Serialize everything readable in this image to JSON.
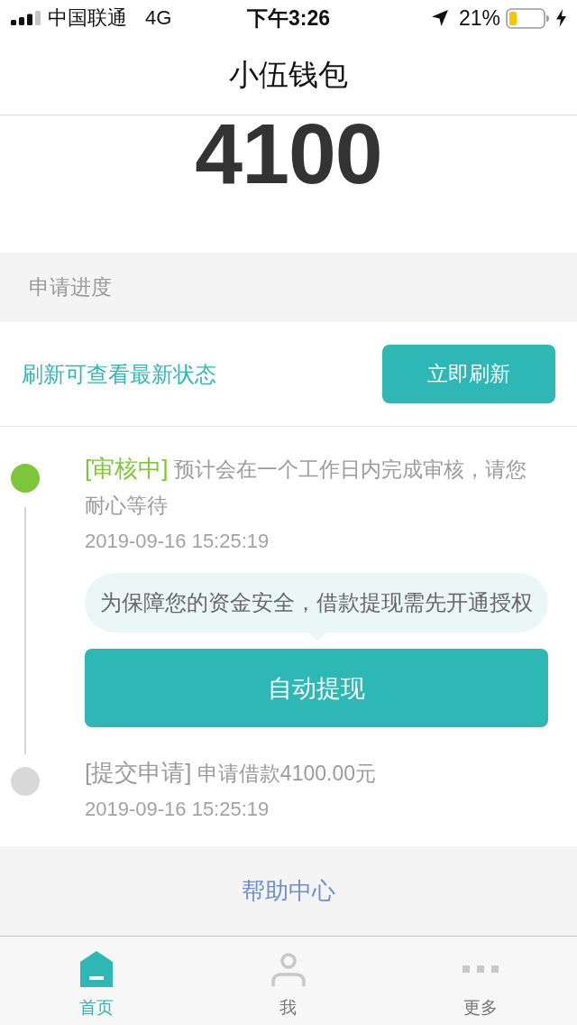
{
  "status_bar": {
    "carrier": "中国联通",
    "network": "4G",
    "time": "下午3:26",
    "battery": "21%"
  },
  "nav": {
    "title": "小伍钱包"
  },
  "amount": "4100",
  "progress": {
    "header": "申请进度",
    "refresh_hint": "刷新可查看最新状态",
    "refresh_button": "立即刷新",
    "steps": [
      {
        "status": "[审核中]",
        "description": "预计会在一个工作日内完成审核，请您耐心等待",
        "time": "2019-09-16 15:25:19",
        "active": true,
        "notice": "为保障您的资金安全，借款提现需先开通授权",
        "action": "自动提现"
      },
      {
        "status": "[提交申请]",
        "description": "申请借款4100.00元",
        "time": "2019-09-16 15:25:19",
        "active": false
      }
    ]
  },
  "help_link": "帮助中心",
  "tab_bar": [
    {
      "kind": "home",
      "label": "首页",
      "selected": true
    },
    {
      "kind": "profile",
      "label": "我",
      "selected": false
    },
    {
      "kind": "more",
      "label": "更多",
      "selected": false
    }
  ]
}
